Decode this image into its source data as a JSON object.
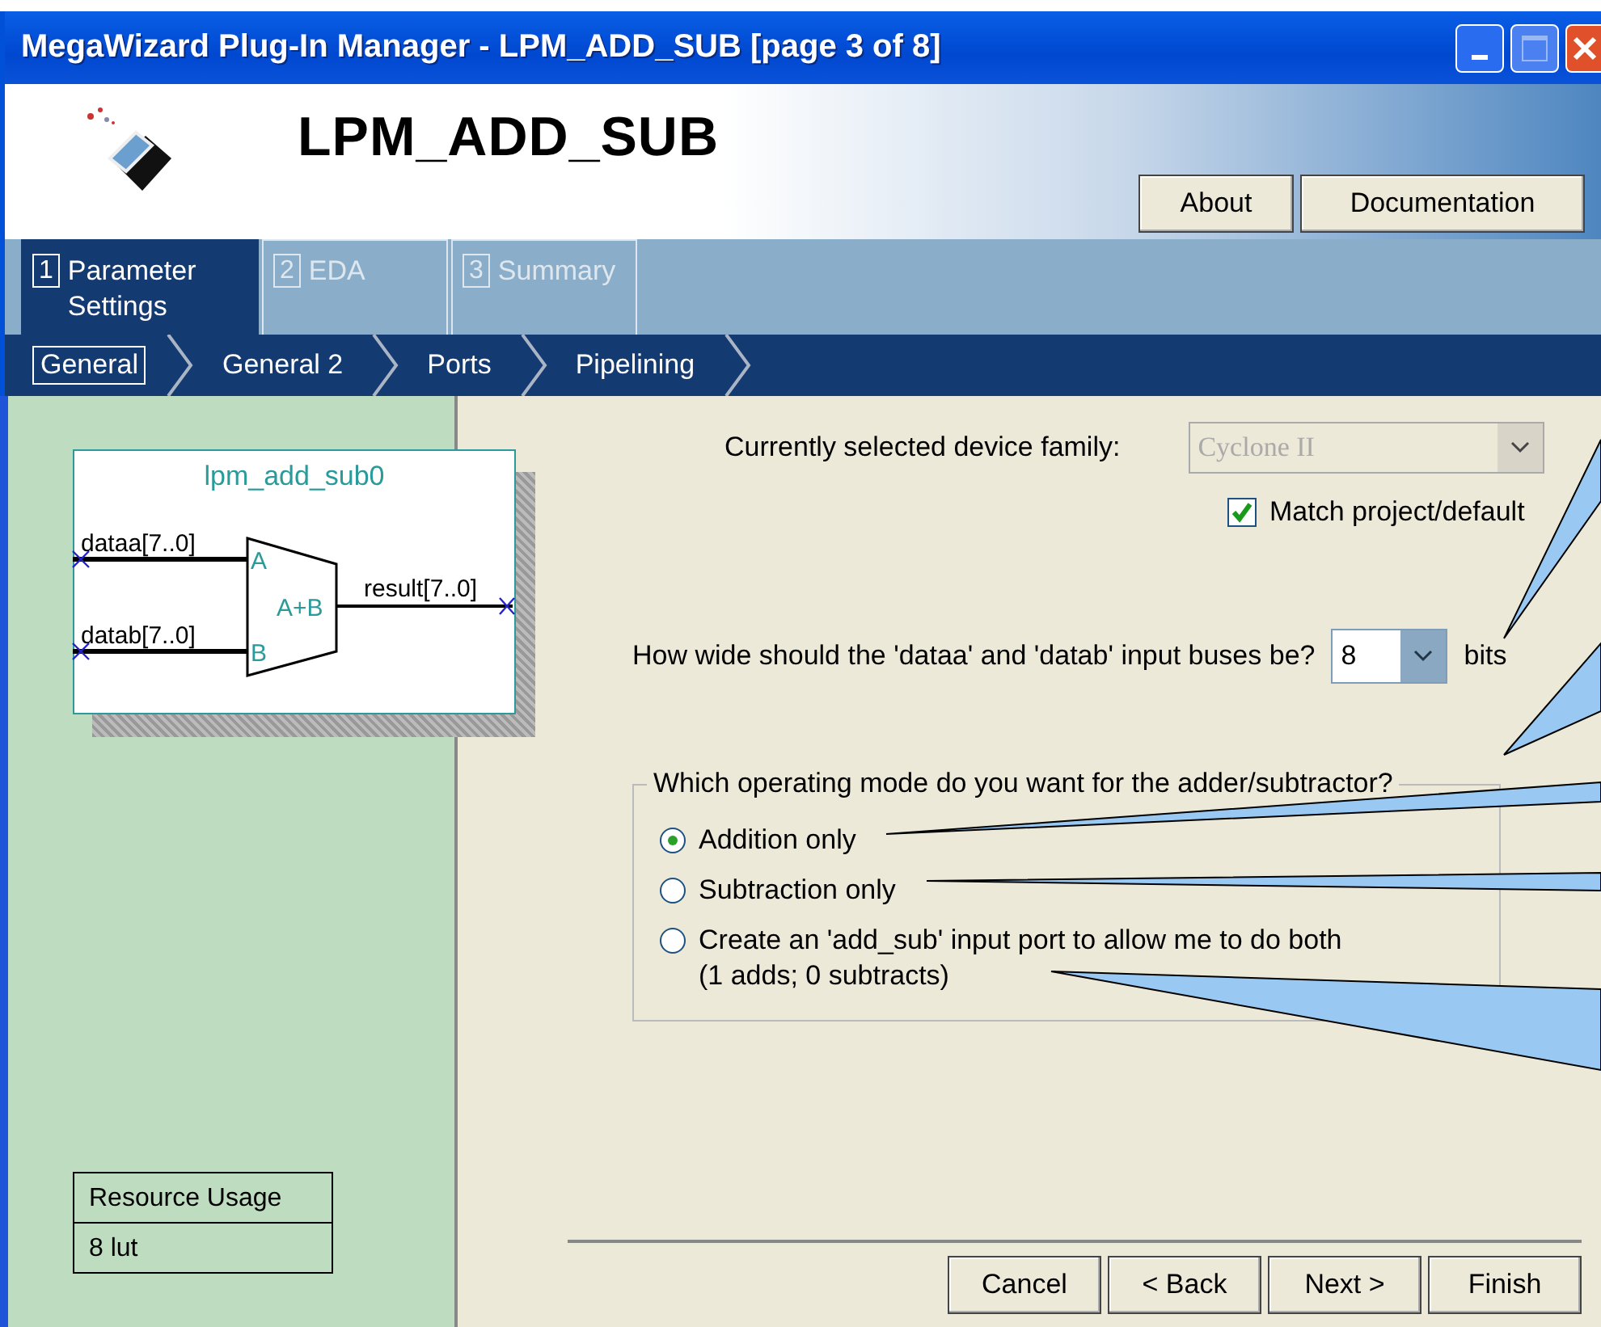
{
  "window": {
    "title": "MegaWizard Plug-In Manager - LPM_ADD_SUB [page 3 of 8]"
  },
  "header": {
    "title": "LPM_ADD_SUB",
    "buttons": [
      "About",
      "Documentation"
    ]
  },
  "tabs": [
    {
      "number": "1",
      "label": "Parameter Settings",
      "selected": true
    },
    {
      "number": "2",
      "label": "EDA",
      "selected": false
    },
    {
      "number": "3",
      "label": "Summary",
      "selected": false
    }
  ],
  "steps": [
    {
      "label": "General",
      "selected": true
    },
    {
      "label": "General 2",
      "selected": false
    },
    {
      "label": "Ports",
      "selected": false
    },
    {
      "label": "Pipelining",
      "selected": false
    }
  ],
  "symbol": {
    "name": "lpm_add_sub0",
    "inputs": [
      {
        "port": "A",
        "signal": "dataa[7..0]"
      },
      {
        "port": "B",
        "signal": "datab[7..0]"
      }
    ],
    "operation": "A+B",
    "output": "result[7..0]"
  },
  "resource_usage": {
    "title": "Resource Usage",
    "value": "8 lut"
  },
  "device": {
    "label": "Currently selected device family:",
    "value": "Cyclone II",
    "disabled": true,
    "match": {
      "label": "Match project/default",
      "checked": true
    }
  },
  "width": {
    "question": "How wide should the 'dataa' and 'datab' input buses be?",
    "value": "8",
    "unit": "bits"
  },
  "mode": {
    "legend": "Which operating mode do you want for the adder/subtractor?",
    "options": [
      {
        "label": "Addition only",
        "selected": true
      },
      {
        "label": "Subtraction only",
        "selected": false
      },
      {
        "label": "Create an 'add_sub' input port to allow me to do both",
        "note": "(1 adds; 0 subtracts)",
        "selected": false
      }
    ]
  },
  "footer": {
    "buttons": [
      "Cancel",
      "< Back",
      "Next >",
      "Finish"
    ]
  }
}
